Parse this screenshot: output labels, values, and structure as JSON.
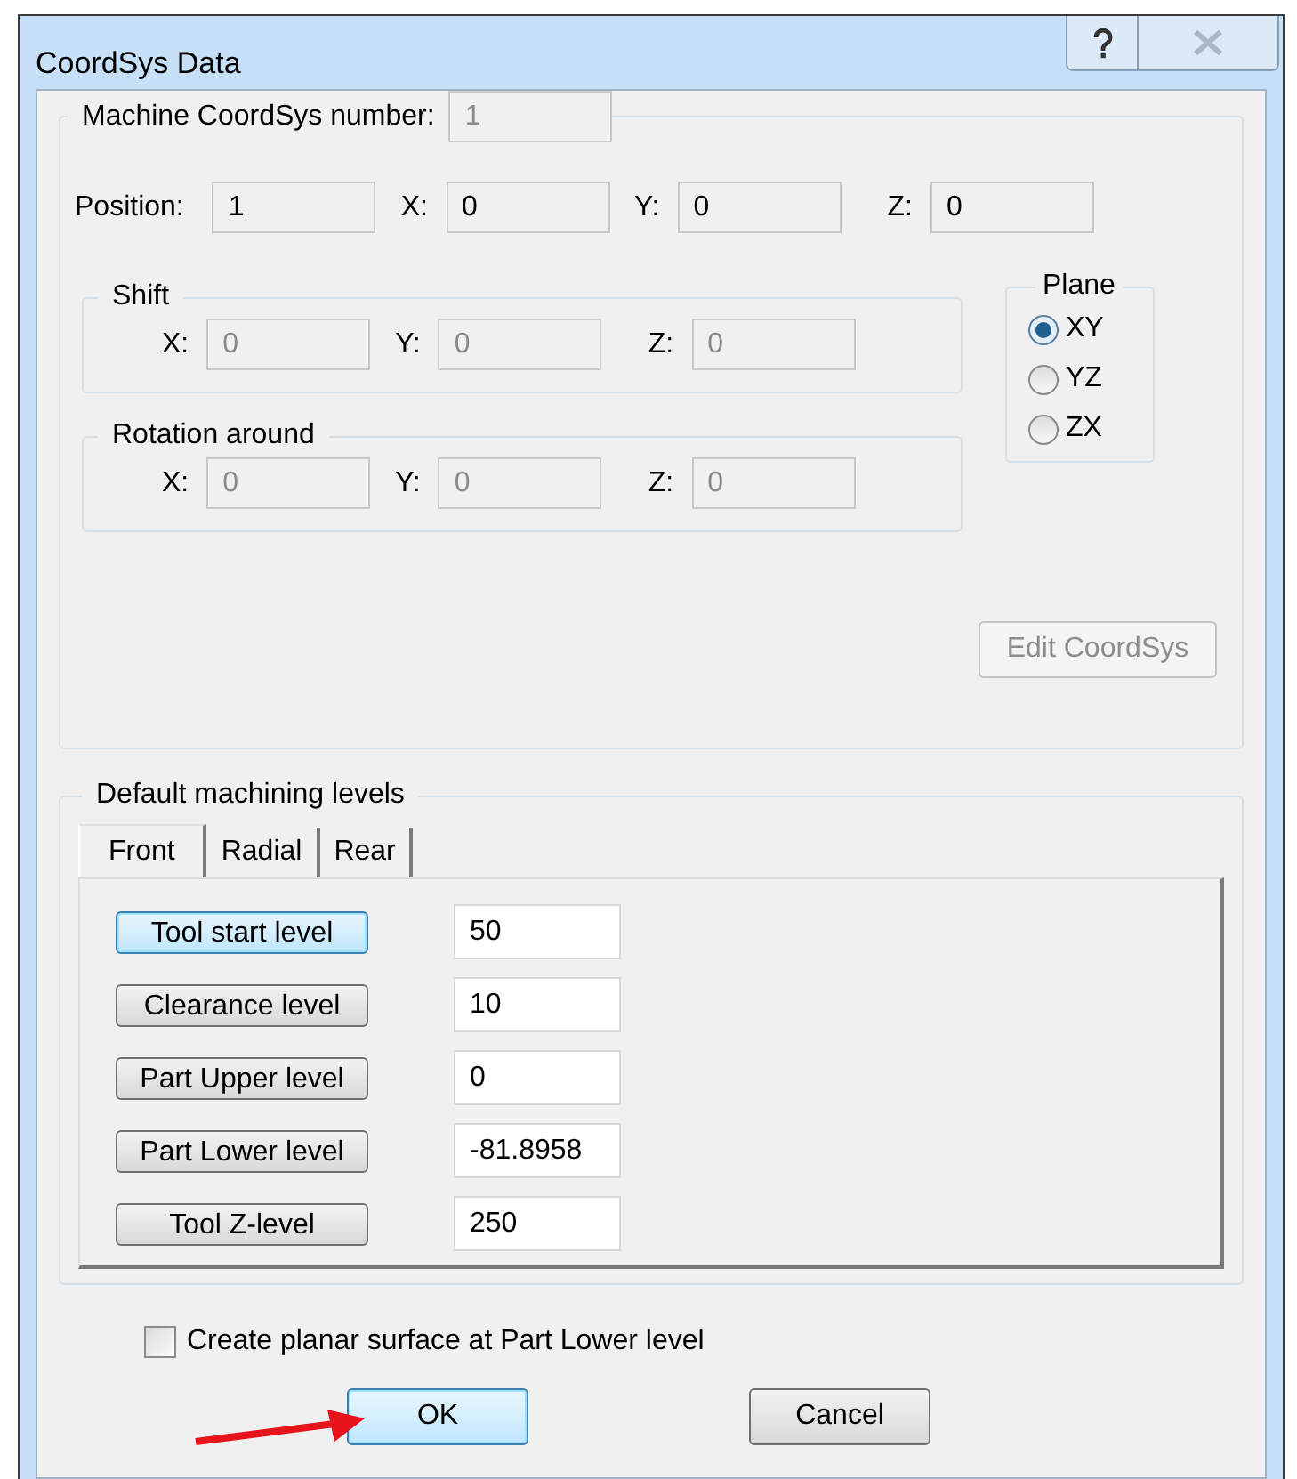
{
  "window": {
    "title": "CoordSys Data"
  },
  "machine": {
    "label": "Machine CoordSys number:",
    "value": "1",
    "disabled": true
  },
  "position": {
    "label": "Position:",
    "value": "1",
    "coords": [
      {
        "label": "X:",
        "value": "0"
      },
      {
        "label": "Y:",
        "value": "0"
      },
      {
        "label": "Z:",
        "value": "0"
      }
    ]
  },
  "shift": {
    "title": "Shift",
    "fields": [
      {
        "label": "X:",
        "value": "0",
        "disabled": true
      },
      {
        "label": "Y:",
        "value": "0",
        "disabled": true
      },
      {
        "label": "Z:",
        "value": "0",
        "disabled": true
      }
    ]
  },
  "rotation": {
    "title": "Rotation around",
    "fields": [
      {
        "label": "X:",
        "value": "0",
        "disabled": true
      },
      {
        "label": "Y:",
        "value": "0",
        "disabled": true
      },
      {
        "label": "Z:",
        "value": "0",
        "disabled": true
      }
    ]
  },
  "plane": {
    "title": "Plane",
    "options": [
      {
        "label": "XY",
        "selected": true
      },
      {
        "label": "YZ",
        "selected": false
      },
      {
        "label": "ZX",
        "selected": false
      }
    ]
  },
  "edit_button": {
    "label": "Edit CoordSys",
    "disabled": true
  },
  "levels": {
    "title": "Default machining levels",
    "tabs": [
      {
        "label": "Front",
        "selected": true
      },
      {
        "label": "Radial",
        "selected": false
      },
      {
        "label": "Rear",
        "selected": false
      }
    ],
    "rows": [
      {
        "button": "Tool start level",
        "value": "50",
        "focused": true
      },
      {
        "button": "Clearance level",
        "value": "10",
        "focused": false
      },
      {
        "button": "Part Upper level",
        "value": "0",
        "focused": false
      },
      {
        "button": "Part Lower level",
        "value": "-81.8958",
        "focused": false
      },
      {
        "button": "Tool Z-level",
        "value": "250",
        "focused": false
      }
    ]
  },
  "checkbox": {
    "label": "Create planar surface at Part Lower level",
    "checked": false
  },
  "buttons": [
    {
      "label": "OK",
      "focused": true
    },
    {
      "label": "Cancel",
      "focused": false
    }
  ]
}
